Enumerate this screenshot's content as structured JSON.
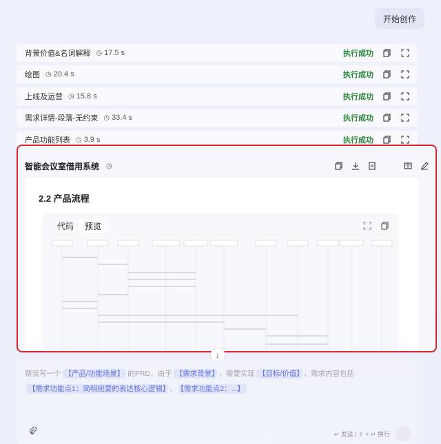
{
  "header": {
    "start_label": "开始创作"
  },
  "tasks": [
    {
      "name": "背景价值&名词解释",
      "duration": "17.5 s",
      "status": "执行成功"
    },
    {
      "name": "绘图",
      "duration": "20.4 s",
      "status": "执行成功"
    },
    {
      "name": "上线及运营",
      "duration": "15.8 s",
      "status": "执行成功"
    },
    {
      "name": "需求详情-段落-无约束",
      "duration": "33.4 s",
      "status": "执行成功"
    },
    {
      "name": "产品功能列表",
      "duration": "3.9 s",
      "status": "执行成功"
    }
  ],
  "panel": {
    "title": "智能会议室借用系统",
    "section_title": "2.2 产品流程",
    "tabs": [
      "代码",
      "预览"
    ],
    "active_tab": "预览"
  },
  "prompt": {
    "prefix": "帮我写一个",
    "chip1": "【产品/功能场景】",
    "mid1": "的PRD，由于",
    "chip2": "【需求背景】",
    "mid2": "，需要实现",
    "chip3": "【目标/价值】",
    "mid3": "，需求内容包括",
    "chip4": "【需求功能点1：简明扼要的表达核心逻辑】",
    "sep": "、",
    "chip5": "【需求功能点2：...】",
    "send_hint": "↵ 发送 / ⇧ + ↵ 换行"
  },
  "colors": {
    "success": "#2a8a3a",
    "highlight_border": "#d8262c",
    "chip": "#4a5bd8"
  }
}
